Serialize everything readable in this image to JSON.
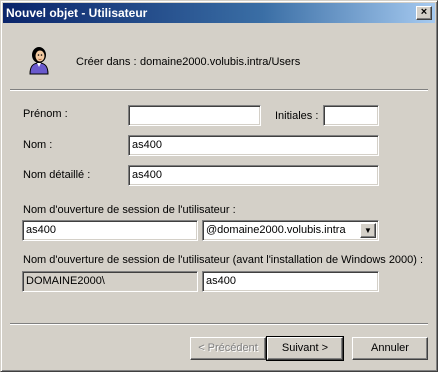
{
  "window": {
    "title": "Nouvel objet - Utilisateur",
    "close_glyph": "×"
  },
  "header": {
    "icon": "user-icon",
    "create_in_label": "Créer dans :",
    "create_in_path": "domaine2000.volubis.intra/Users"
  },
  "form": {
    "prenom": {
      "label": "Prénom :",
      "value": ""
    },
    "initiales": {
      "label": "Initiales :",
      "value": ""
    },
    "nom": {
      "label": "Nom :",
      "value": "as400"
    },
    "nom_detaille": {
      "label": "Nom détaillé :",
      "value": "as400"
    },
    "logon": {
      "label": "Nom d'ouverture de session de l'utilisateur :",
      "value": "as400",
      "domain_selected": "@domaine2000.volubis.intra"
    },
    "logon_pre2000": {
      "label": "Nom d'ouverture de session de l'utilisateur (avant l'installation de Windows 2000) :",
      "domain": "DOMAINE2000\\",
      "value": "as400"
    }
  },
  "buttons": {
    "back": "< Précédent",
    "next": "Suivant >",
    "cancel": "Annuler"
  }
}
